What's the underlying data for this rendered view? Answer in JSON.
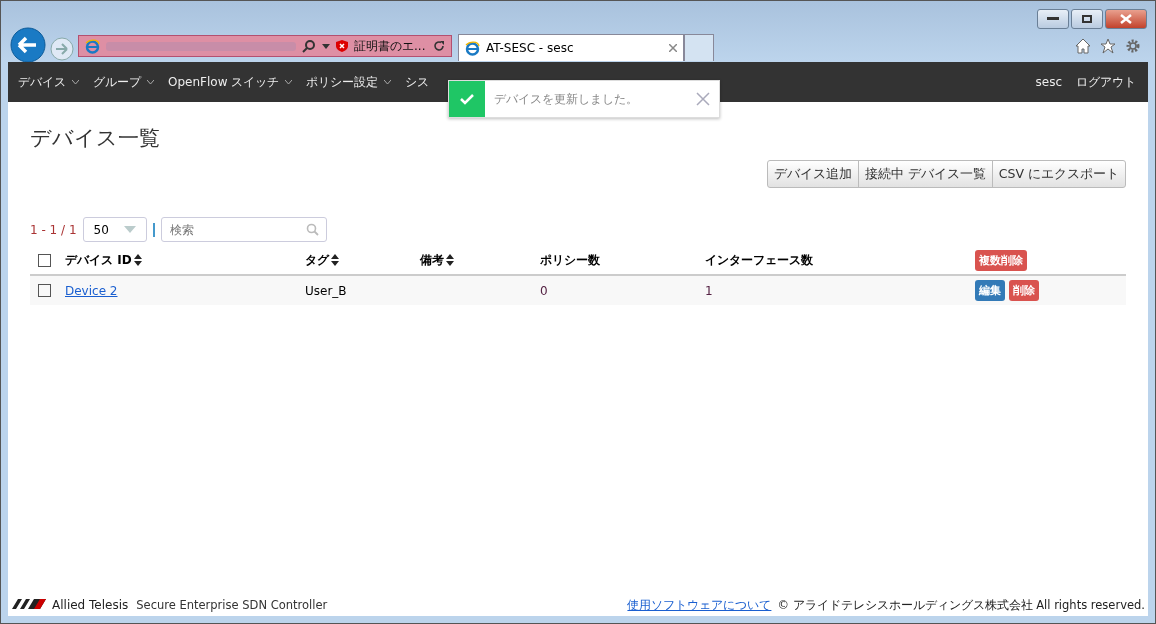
{
  "browser": {
    "cert_error": "証明書のエ...",
    "tabs": [
      {
        "title": "AT-SESC - sesc",
        "selected": true
      }
    ]
  },
  "nav": {
    "items": [
      {
        "label": "デバイス",
        "dropdown": true
      },
      {
        "label": "グループ",
        "dropdown": true
      },
      {
        "label": "OpenFlow スイッチ",
        "dropdown": true
      },
      {
        "label": "ポリシー設定",
        "dropdown": true
      },
      {
        "label": "シス",
        "dropdown": false
      }
    ],
    "user": "sesc",
    "logout": "ログアウト"
  },
  "toast": {
    "message": "デバイスを更新しました。"
  },
  "page": {
    "title": "デバイス一覧",
    "actions": [
      "デバイス追加",
      "接続中 デバイス一覧",
      "CSV にエクスポート"
    ]
  },
  "pager": {
    "range": "1 - 1 / 1",
    "page_size": "50",
    "search_placeholder": "検索"
  },
  "table": {
    "all_checked": false,
    "columns": [
      {
        "label": "デバイス ID",
        "sortable": true
      },
      {
        "label": "タグ",
        "sortable": true
      },
      {
        "label": "備考",
        "sortable": true
      },
      {
        "label": "ポリシー数",
        "sortable": false
      },
      {
        "label": "インターフェース数",
        "sortable": false
      }
    ],
    "bulk_delete": "複数削除",
    "rows": [
      {
        "checked": false,
        "cells": [
          "Device 2",
          "User_B",
          "",
          "0",
          "1"
        ],
        "edit": "編集",
        "delete": "削除"
      }
    ]
  },
  "footer": {
    "brand": "Allied Telesis",
    "product": "Secure Enterprise SDN Controller",
    "link": "使用ソフトウェアについて",
    "copyright": "© アライドテレシスホールディングス株式会社 All rights reserved."
  }
}
